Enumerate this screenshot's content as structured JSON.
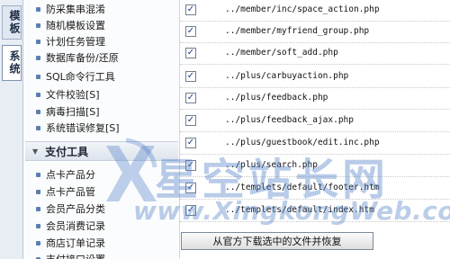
{
  "tabs": [
    {
      "label": "模板"
    },
    {
      "label": "系统"
    }
  ],
  "menu": {
    "items_top": [
      {
        "label": "防采集串混淆"
      },
      {
        "label": "随机模板设置"
      },
      {
        "label": "计划任务管理"
      },
      {
        "label": "数据库备份/还原"
      },
      {
        "label": "SQL命令行工具"
      },
      {
        "label": "文件校验[S]"
      },
      {
        "label": "病毒扫描[S]"
      },
      {
        "label": "系统错误修复[S]"
      }
    ],
    "section_title": "支付工具",
    "items_bottom": [
      {
        "label": "点卡产品分"
      },
      {
        "label": "点卡产品管"
      },
      {
        "label": "会员产品分类"
      },
      {
        "label": "会员消费记录"
      },
      {
        "label": "商店订单记录"
      },
      {
        "label": "支付接口设置"
      }
    ]
  },
  "files": [
    {
      "path": "../member/inc/space_action.php",
      "checked": true
    },
    {
      "path": "../member/myfriend_group.php",
      "checked": true
    },
    {
      "path": "../member/soft_add.php",
      "checked": true
    },
    {
      "path": "../plus/carbuyaction.php",
      "checked": true
    },
    {
      "path": "../plus/feedback.php",
      "checked": true
    },
    {
      "path": "../plus/feedback_ajax.php",
      "checked": true
    },
    {
      "path": "../plus/guestbook/edit.inc.php",
      "checked": true
    },
    {
      "path": "../plus/search.php",
      "checked": true
    },
    {
      "path": "../templets/default/footer.htm",
      "checked": true
    },
    {
      "path": "../templets/default/index.htm",
      "checked": true
    }
  ],
  "restore_button_label": "从官方下载选中的文件并恢复",
  "watermark": {
    "title": "星空站长网",
    "url": "www.XingkongWeb.com",
    "color": "#5684c8"
  },
  "colors": {
    "menu_bullet": "#5b7fb0",
    "checkmark": "#1f3d78",
    "tab_strip": "#e9eef5"
  }
}
